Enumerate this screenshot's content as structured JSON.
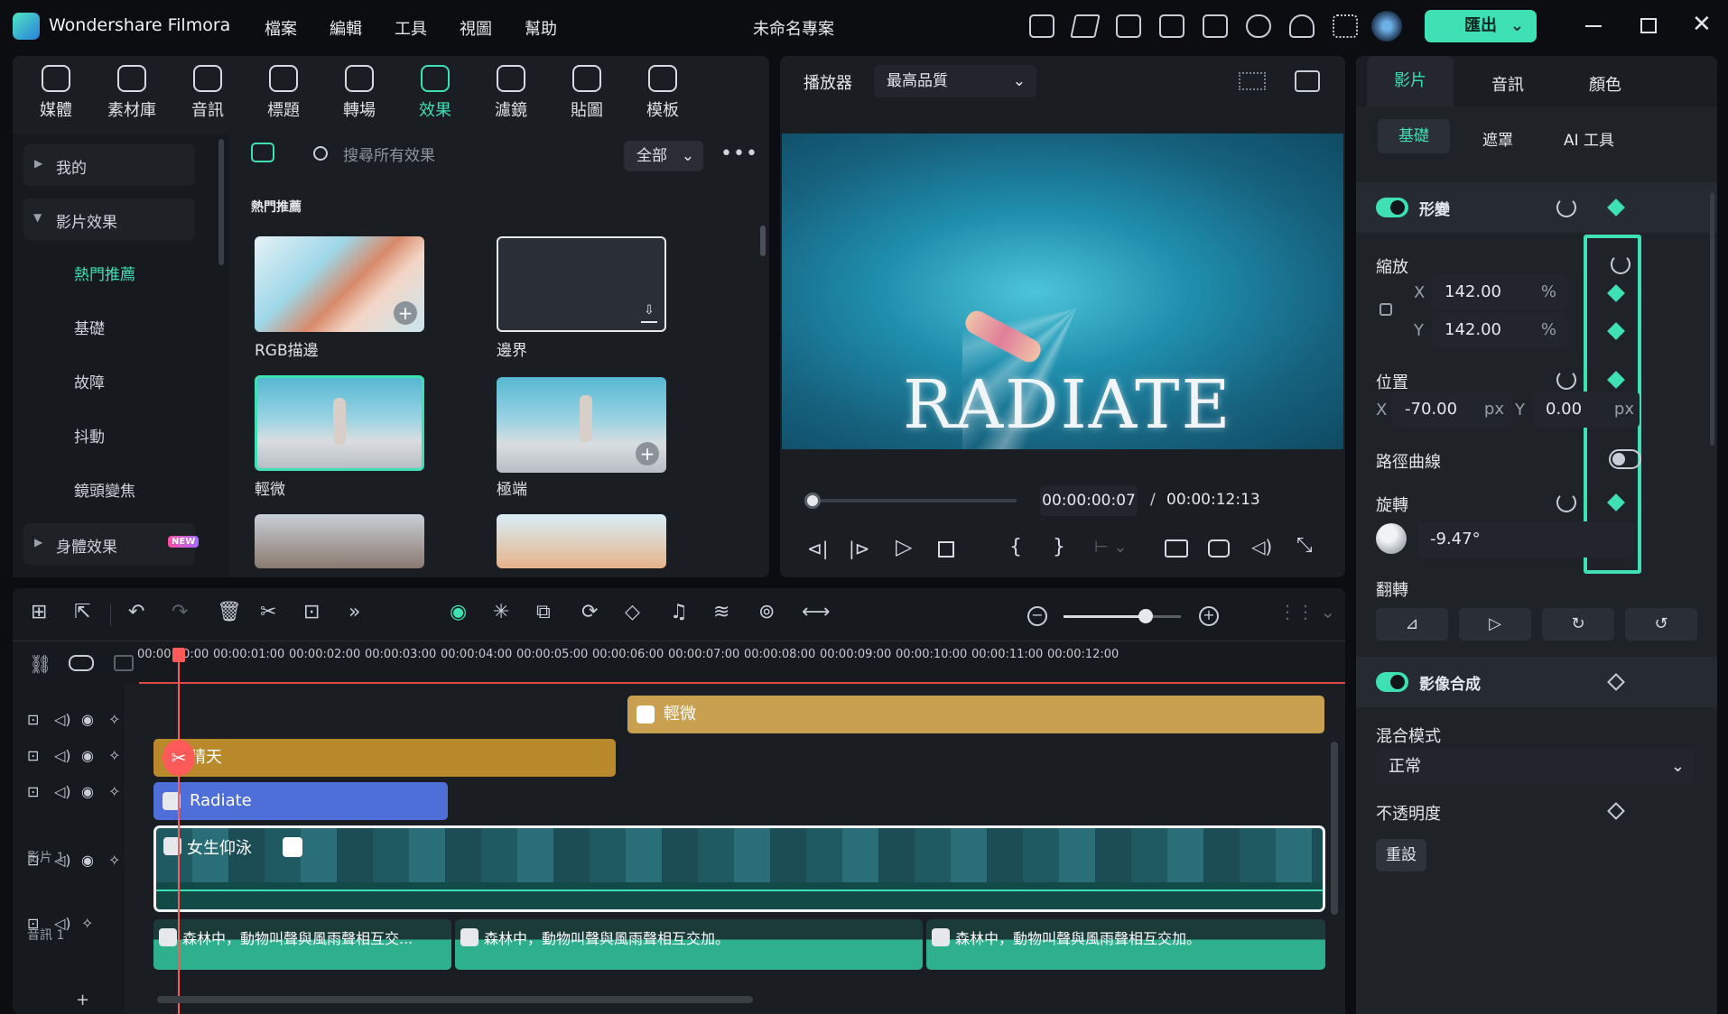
{
  "app": {
    "name": "Wondershare Filmora",
    "project_title": "未命名專案"
  },
  "menu": [
    "檔案",
    "編輯",
    "工具",
    "視圖",
    "幫助"
  ],
  "export_label": "匯出",
  "toolbar": [
    {
      "label": "媒體",
      "icon": "media-icon"
    },
    {
      "label": "素材庫",
      "icon": "library-icon"
    },
    {
      "label": "音訊",
      "icon": "music-icon"
    },
    {
      "label": "標題",
      "icon": "title-icon"
    },
    {
      "label": "轉場",
      "icon": "transition-icon"
    },
    {
      "label": "效果",
      "icon": "effects-icon",
      "active": true
    },
    {
      "label": "濾鏡",
      "icon": "filter-icon"
    },
    {
      "label": "貼圖",
      "icon": "sticker-icon"
    },
    {
      "label": "模板",
      "icon": "template-icon"
    }
  ],
  "sidebar": {
    "items": [
      "我的",
      "影片效果",
      "熱門推薦",
      "基礎",
      "故障",
      "抖動",
      "鏡頭變焦",
      "身體效果"
    ],
    "new_badge": "NEW"
  },
  "effects": {
    "search_placeholder": "搜尋所有效果",
    "filter_label": "全部",
    "section_title": "熱門推薦",
    "items": [
      "RGB描邊",
      "邊界",
      "輕微",
      "極端"
    ]
  },
  "player": {
    "label": "播放器",
    "quality": "最高品質",
    "overlay_title": "RADIATE",
    "current_time": "00:00:00:07",
    "separator": "/",
    "total_time": "00:00:12:13",
    "progress": 0.01
  },
  "timeline": {
    "ruler": [
      "00:00:00:00",
      "00:00:01:00",
      "00:00:02:00",
      "00:00:03:00",
      "00:00:04:00",
      "00:00:05:00",
      "00:00:06:00",
      "00:00:07:00",
      "00:00:08:00",
      "00:00:09:00",
      "00:00:10:00",
      "00:00:11:00",
      "00:00:12:00"
    ],
    "clips": {
      "effect": "輕微",
      "filter": "晴天",
      "title": "Radiate",
      "video": "女生仰泳",
      "audio": "森林中，動物叫聲與風雨聲相互交加。",
      "audio_short": "森林中，動物叫聲與風雨聲相互交..."
    },
    "track_labels": {
      "video": "影片 1",
      "audio": "音訊 1"
    },
    "add_track": "+",
    "zoom_level": 0.7
  },
  "inspector": {
    "tabs": [
      "影片",
      "音訊",
      "顏色"
    ],
    "subtabs": [
      "基礎",
      "遮罩",
      "AI 工具"
    ],
    "transform_label": "形變",
    "scale_label": "縮放",
    "scale_x": "142.00",
    "scale_y": "142.00",
    "percent": "%",
    "axis_x": "X",
    "axis_y": "Y",
    "position_label": "位置",
    "pos_x": "-70.00",
    "pos_y": "0.00",
    "px": "px",
    "path_curve_label": "路徑曲線",
    "rotate_label": "旋轉",
    "rotate_value": "-9.47°",
    "flip_label": "翻轉",
    "compositing_label": "影像合成",
    "blend_label": "混合模式",
    "blend_value": "正常",
    "opacity_label": "不透明度",
    "reset_label": "重設"
  },
  "colors": {
    "accent": "#3fe0b4",
    "effect_clip": "#c8a050",
    "filter_clip": "#b98a2c",
    "title_clip": "#4f6fd8",
    "playhead": "#ff5a5a"
  }
}
